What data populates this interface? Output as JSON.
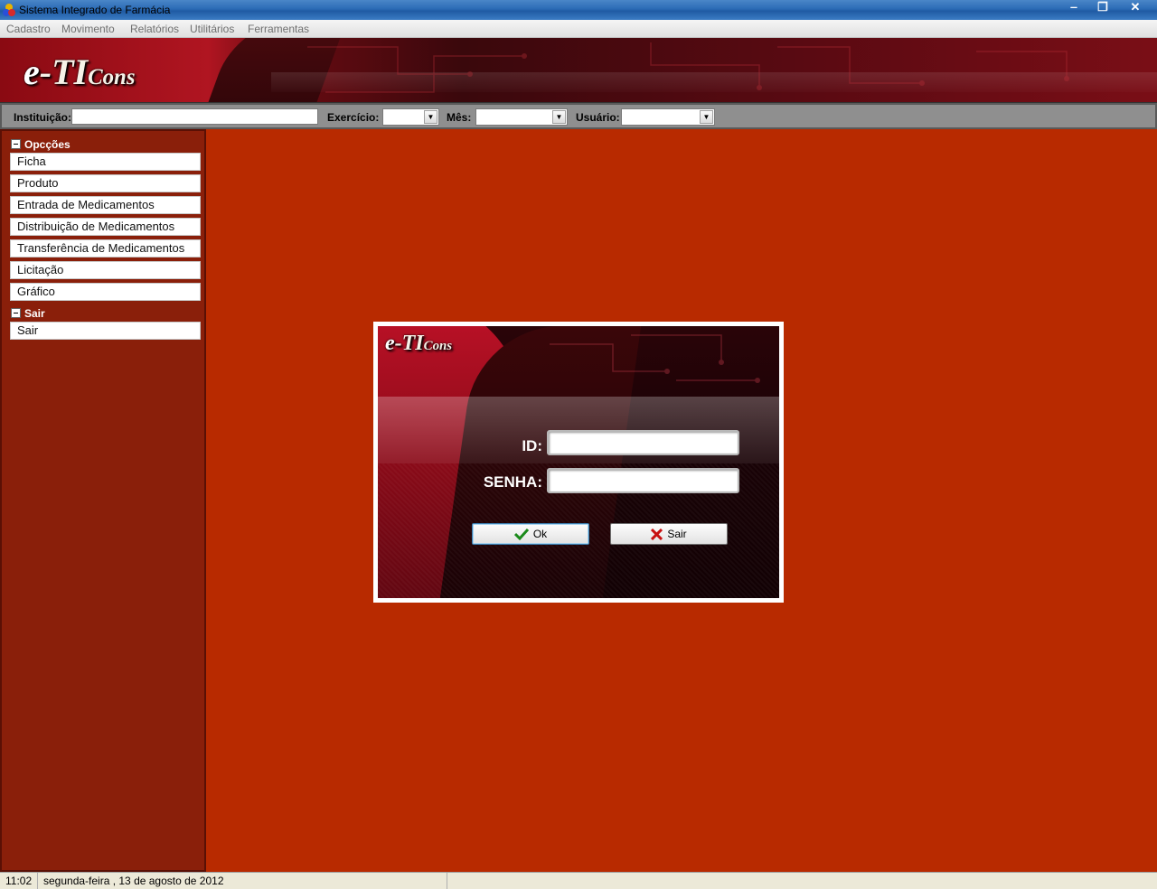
{
  "window": {
    "title": "Sistema Integrado de Farmácia",
    "minimize": "‒",
    "maximize": "❐",
    "close": "✕"
  },
  "menu": [
    "Cadastro",
    "Movimento",
    "Relatórios",
    "Utilitários",
    "Ferramentas"
  ],
  "banner": {
    "logo_e": "e",
    "logo_ti": "-TI",
    "logo_cons": "Cons"
  },
  "filters": {
    "instituicao_label": "Instituição:",
    "instituicao_value": "",
    "exercicio_label": "Exercício:",
    "exercicio_value": "",
    "mes_label": "Mês:",
    "mes_value": "",
    "usuario_label": "Usuário:",
    "usuario_value": ""
  },
  "sidebar": {
    "groups": [
      {
        "title": "Opcções",
        "items": [
          "Ficha",
          "Produto",
          "Entrada de Medicamentos",
          "Distribuição de Medicamentos",
          "Transferência de Medicamentos",
          "Licitação",
          "Gráfico"
        ]
      },
      {
        "title": "Sair",
        "items": [
          "Sair"
        ]
      }
    ]
  },
  "login": {
    "logo_e": "e",
    "logo_ti": "-TI",
    "logo_cons": "Cons",
    "id_label": "ID:",
    "id_value": "",
    "senha_label": "SENHA:",
    "senha_value": "",
    "ok_label": "Ok",
    "sair_label": "Sair"
  },
  "status": {
    "time": "11:02",
    "date": "segunda-feira , 13 de agosto de 2012"
  },
  "colors": {
    "main_bg": "#b82a00",
    "sidebar_bg": "#8a1f0a",
    "accent_red": "#b01521"
  }
}
